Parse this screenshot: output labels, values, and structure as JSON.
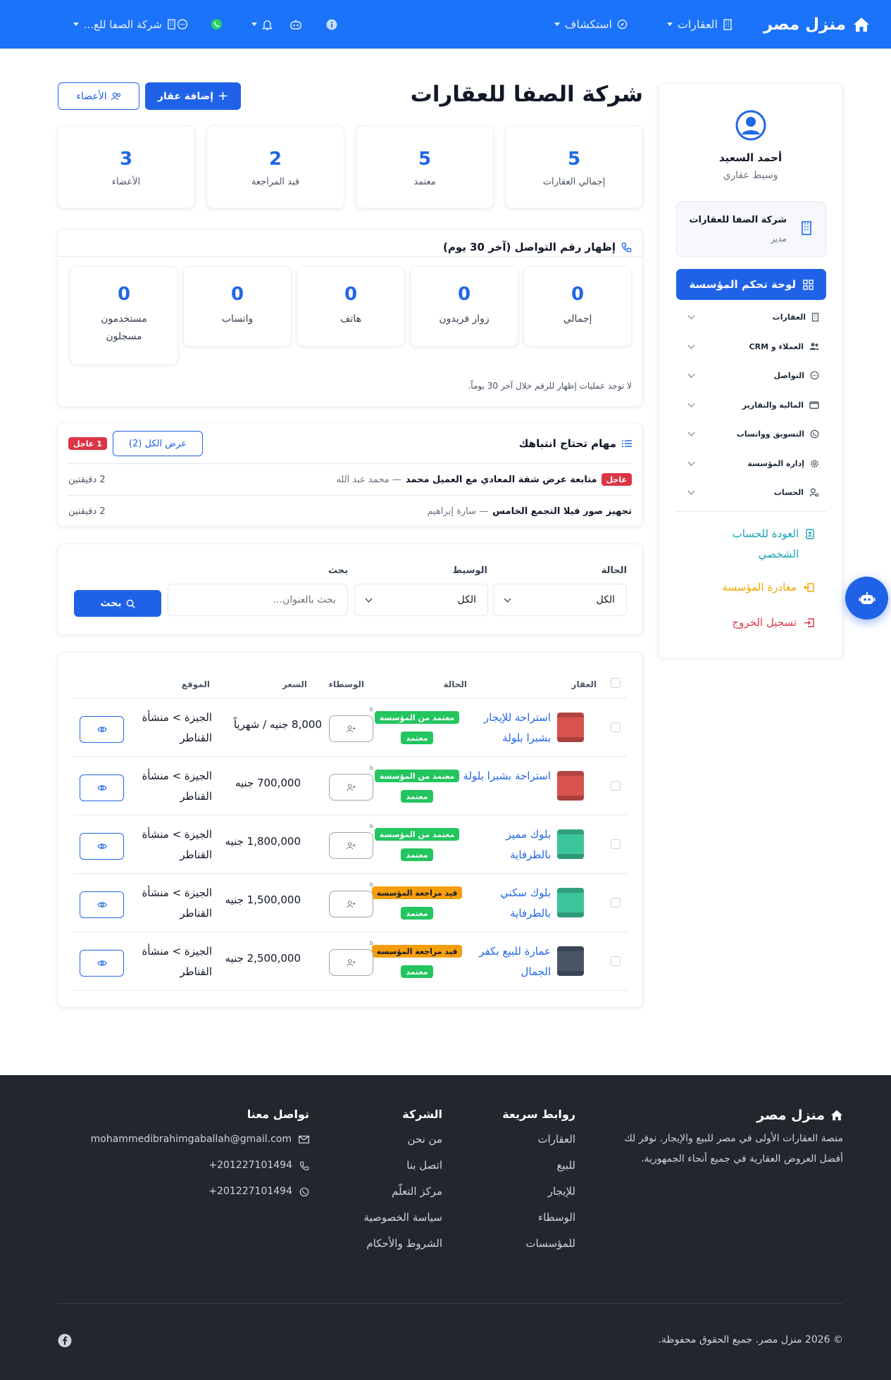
{
  "navbar": {
    "brand": "منزل مصر",
    "properties": "العقارات",
    "explore": "استكشاف",
    "company": "شركة الصفا للع..."
  },
  "sidebar": {
    "user_name": "أحمد السعيد",
    "user_role": "وسيط عقاري",
    "org_name": "شركة الصفا للعقارات",
    "org_role": "مدير",
    "dashboard_button": "لوحة تحكم المؤسسة",
    "menu": [
      {
        "label": "العقارات",
        "icon": "building-icon"
      },
      {
        "label": "العملاء و CRM",
        "icon": "users-icon"
      },
      {
        "label": "التواصل",
        "icon": "chat-icon"
      },
      {
        "label": "المالية والتقارير",
        "icon": "wallet-icon"
      },
      {
        "label": "التسويق وواتساب",
        "icon": "whatsapp-icon"
      },
      {
        "label": "إدارة المؤسسة",
        "icon": "gear-icon"
      },
      {
        "label": "الحساب",
        "icon": "user-gear-icon"
      }
    ],
    "back_personal": "العودة للحساب الشخصي",
    "leave_org": "مغادرة المؤسسة",
    "logout": "تسجيل الخروج",
    "colors": {
      "back": "#17a2b8",
      "leave": "#f0a500",
      "logout": "#dc3545"
    }
  },
  "header": {
    "title": "شركة الصفا للعقارات",
    "add_property": "إضافة عقار",
    "members": "الأعضاء"
  },
  "stats": [
    {
      "value": "5",
      "label": "إجمالي العقارات"
    },
    {
      "value": "5",
      "label": "معتمد"
    },
    {
      "value": "2",
      "label": "قيد المراجعة"
    },
    {
      "value": "3",
      "label": "الأعضاء"
    }
  ],
  "contact_panel": {
    "title": "إظهار رقم التواصل (آخر 30 يوم)",
    "cards": [
      {
        "value": "0",
        "label": "إجمالي"
      },
      {
        "value": "0",
        "label": "زوار فريدون"
      },
      {
        "value": "0",
        "label": "هاتف"
      },
      {
        "value": "0",
        "label": "واتساب"
      },
      {
        "value": "0",
        "label": "مستخدمون مسجلون"
      }
    ],
    "empty_note": "لا توجد عمليات إظهار للرقم خلال آخر 30 يوماً."
  },
  "tasks": {
    "title": "مهام تحتاج انتباهك",
    "urgent_count": "1 عاجل",
    "view_all": "عرض الكل (2)",
    "items": [
      {
        "badge": "عاجل",
        "title": "متابعة عرض شقة المعادي مع العميل محمد",
        "person": "— محمد عبد الله",
        "time": "2 دقيقتين"
      },
      {
        "title": "تجهيز صور فيلا التجمع الخامس",
        "person": "— سارة إبراهيم",
        "time": "2 دقيقتين"
      }
    ]
  },
  "filters": {
    "status_label": "الحالة",
    "status_value": "الكل",
    "agent_label": "الوسيط",
    "agent_value": "الكل",
    "search_label": "بحث",
    "search_placeholder": "بحث بالعنوان...",
    "search_button": "بحث"
  },
  "table": {
    "headers": {
      "property": "العقار",
      "status": "الحالة",
      "agents": "الوسطاء",
      "price": "السعر",
      "location": "الموقع"
    },
    "rows": [
      {
        "title": "استراحة للإيجار بشبرا بلولة",
        "status1": "معتمد من المؤسسة",
        "status1_type": "green",
        "status2": "معتمد",
        "agent": "b",
        "price": "8,000 جنيه / شهرياً",
        "location": "الجيزة > منشأة القناطر",
        "thumb_color": "#d9534f"
      },
      {
        "title": "استراحة بشبرا بلولة",
        "status1": "معتمد من المؤسسة",
        "status1_type": "green",
        "status2": "معتمد",
        "agent": "b",
        "price": "700,000 جنيه",
        "location": "الجيزة > منشأة القناطر",
        "thumb_color": "#d9534f"
      },
      {
        "title": "بلوك مميز بالطرفاية",
        "status1": "معتمد من المؤسسة",
        "status1_type": "green",
        "status2": "معتمد",
        "agent": "b",
        "price": "1,800,000 جنيه",
        "location": "الجيزة > منشأة القناطر",
        "thumb_color": "#3cc49b"
      },
      {
        "title": "بلوك سكني بالطرفاية",
        "status1": "قيد مراجعة المؤسسة",
        "status1_type": "amber",
        "status2": "معتمد",
        "agent": "b",
        "price": "1,500,000 جنيه",
        "location": "الجيزة > منشأة القناطر",
        "thumb_color": "#3cc49b"
      },
      {
        "title": "عمارة للبيع بكفر الجمال",
        "status1": "قيد مراجعة المؤسسة",
        "status1_type": "amber",
        "status2": "معتمد",
        "agent": "b",
        "price": "2,500,000 جنيه",
        "location": "الجيزة > منشأة القناطر",
        "thumb_color": "#4a5568"
      }
    ]
  },
  "footer": {
    "brand": "منزل مصر",
    "description": "منصة العقارات الأولى في مصر للبيع والإيجار. نوفر لك أفضل العروض العقارية في جميع أنحاء الجمهورية.",
    "quick_title": "روابط سريعة",
    "quick_links": [
      "العقارات",
      "للبيع",
      "للإيجار",
      "الوسطاء",
      "للمؤسسات"
    ],
    "company_title": "الشركة",
    "company_links": [
      "من نحن",
      "اتصل بنا",
      "مركز التعلّم",
      "سياسة الخصوصية",
      "الشروط والأحكام"
    ],
    "contact_title": "تواصل معنا",
    "email": "mohammedibrahimgaballah@gmail.com",
    "phone": "+201227101494",
    "whatsapp": "+201227101494",
    "copyright": "© 2026 منزل مصر. جميع الحقوق محفوظة."
  },
  "colors": {
    "primary": "#1a73f8",
    "button": "#1f62e8",
    "footer_bg": "#22262d"
  }
}
